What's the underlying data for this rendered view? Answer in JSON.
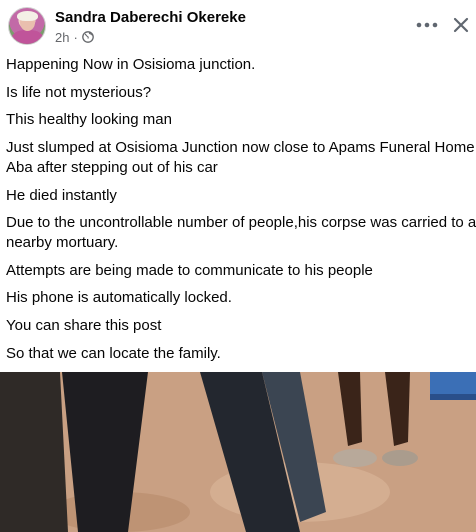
{
  "post": {
    "author": "Sandra Daberechi Okereke",
    "time": "2h",
    "privacy_icon": "globe-icon",
    "actions": {
      "more_icon": "more-horizontal-icon",
      "close_icon": "close-icon"
    },
    "lines": [
      "Happening Now in Osisioma junction.",
      "Is life not mysterious?",
      "This healthy looking man",
      "Just slumped at Osisioma Junction now close to Apams Funeral Home",
      "Aba after stepping out of his car",
      "He died instantly",
      "Due to the uncontrollable number of people,his corpse was carried to a",
      "nearby mortuary.",
      "Attempts are being made to communicate to his people",
      "His phone is automatically locked.",
      "You can share this post",
      "So that we can locate the family."
    ]
  },
  "colors": {
    "text": "#050505",
    "secondary_text": "#65676b",
    "background": "#ffffff"
  }
}
